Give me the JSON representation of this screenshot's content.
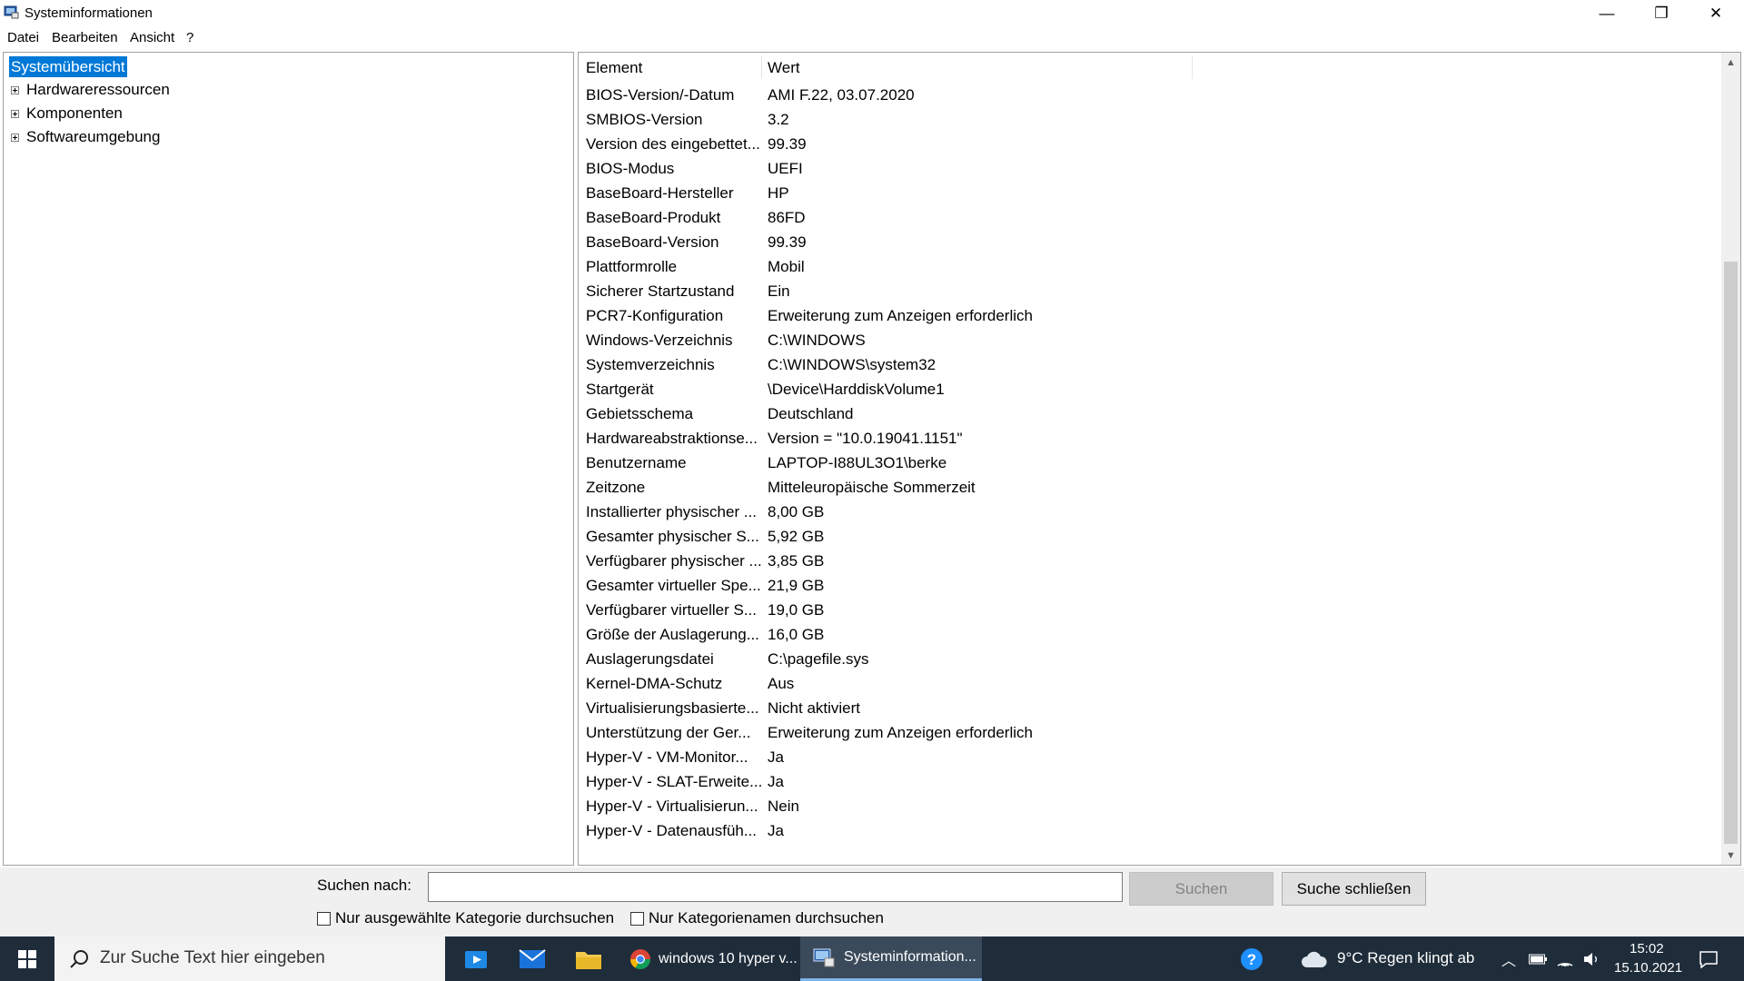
{
  "window": {
    "title": "Systeminformationen",
    "minimize_glyph": "—",
    "restore_glyph": "❐",
    "close_glyph": "✕"
  },
  "menu": [
    "Datei",
    "Bearbeiten",
    "Ansicht",
    "?"
  ],
  "tree": {
    "selected": "Systemübersicht",
    "children": [
      "Hardwareressourcen",
      "Komponenten",
      "Softwareumgebung"
    ]
  },
  "list": {
    "columns": [
      "Element",
      "Wert"
    ],
    "rows": [
      {
        "element": "BIOS-Version/-Datum",
        "value": "AMI F.22, 03.07.2020"
      },
      {
        "element": "SMBIOS-Version",
        "value": "3.2"
      },
      {
        "element": "Version des eingebettet...",
        "value": "99.39"
      },
      {
        "element": "BIOS-Modus",
        "value": "UEFI"
      },
      {
        "element": "BaseBoard-Hersteller",
        "value": "HP"
      },
      {
        "element": "BaseBoard-Produkt",
        "value": "86FD"
      },
      {
        "element": "BaseBoard-Version",
        "value": "99.39"
      },
      {
        "element": "Plattformrolle",
        "value": "Mobil"
      },
      {
        "element": "Sicherer Startzustand",
        "value": "Ein"
      },
      {
        "element": "PCR7-Konfiguration",
        "value": "Erweiterung zum Anzeigen erforderlich"
      },
      {
        "element": "Windows-Verzeichnis",
        "value": "C:\\WINDOWS"
      },
      {
        "element": "Systemverzeichnis",
        "value": "C:\\WINDOWS\\system32"
      },
      {
        "element": "Startgerät",
        "value": "\\Device\\HarddiskVolume1"
      },
      {
        "element": "Gebietsschema",
        "value": "Deutschland"
      },
      {
        "element": "Hardwareabstraktionse...",
        "value": "Version = \"10.0.19041.1151\""
      },
      {
        "element": "Benutzername",
        "value": "LAPTOP-I88UL3O1\\berke"
      },
      {
        "element": "Zeitzone",
        "value": "Mitteleuropäische Sommerzeit"
      },
      {
        "element": "Installierter physischer ...",
        "value": "8,00 GB"
      },
      {
        "element": "Gesamter physischer S...",
        "value": "5,92 GB"
      },
      {
        "element": "Verfügbarer physischer ...",
        "value": "3,85 GB"
      },
      {
        "element": "Gesamter virtueller Spe...",
        "value": "21,9 GB"
      },
      {
        "element": "Verfügbarer virtueller S...",
        "value": "19,0 GB"
      },
      {
        "element": "Größe der Auslagerung...",
        "value": "16,0 GB"
      },
      {
        "element": "Auslagerungsdatei",
        "value": "C:\\pagefile.sys"
      },
      {
        "element": "Kernel-DMA-Schutz",
        "value": "Aus"
      },
      {
        "element": "Virtualisierungsbasierte...",
        "value": "Nicht aktiviert"
      },
      {
        "element": "Unterstützung der Ger...",
        "value": "Erweiterung zum Anzeigen erforderlich"
      },
      {
        "element": "Hyper-V - VM-Monitor...",
        "value": "Ja"
      },
      {
        "element": "Hyper-V - SLAT-Erweite...",
        "value": "Ja"
      },
      {
        "element": "Hyper-V - Virtualisierun...",
        "value": "Nein"
      },
      {
        "element": "Hyper-V - Datenausfüh...",
        "value": "Ja"
      }
    ]
  },
  "search": {
    "label": "Suchen nach:",
    "value": "",
    "search_button": "Suchen",
    "close_button": "Suche schließen",
    "checkbox_selected_category": "Nur ausgewählte Kategorie durchsuchen",
    "checkbox_category_names": "Nur Kategorienamen durchsuchen"
  },
  "taskbar": {
    "search_placeholder": "Zur Suche Text hier eingeben",
    "apps": [
      {
        "label": "windows 10 hyper v...",
        "icon": "chrome-icon"
      },
      {
        "label": "Systeminformation...",
        "icon": "system-information-icon"
      }
    ],
    "weather": "9°C  Regen klingt ab",
    "time": "15:02",
    "date": "15.10.2021"
  },
  "colors": {
    "selection": "#0078d7",
    "taskbar": "#1f2d3b",
    "button_face": "#e1e1e1"
  }
}
